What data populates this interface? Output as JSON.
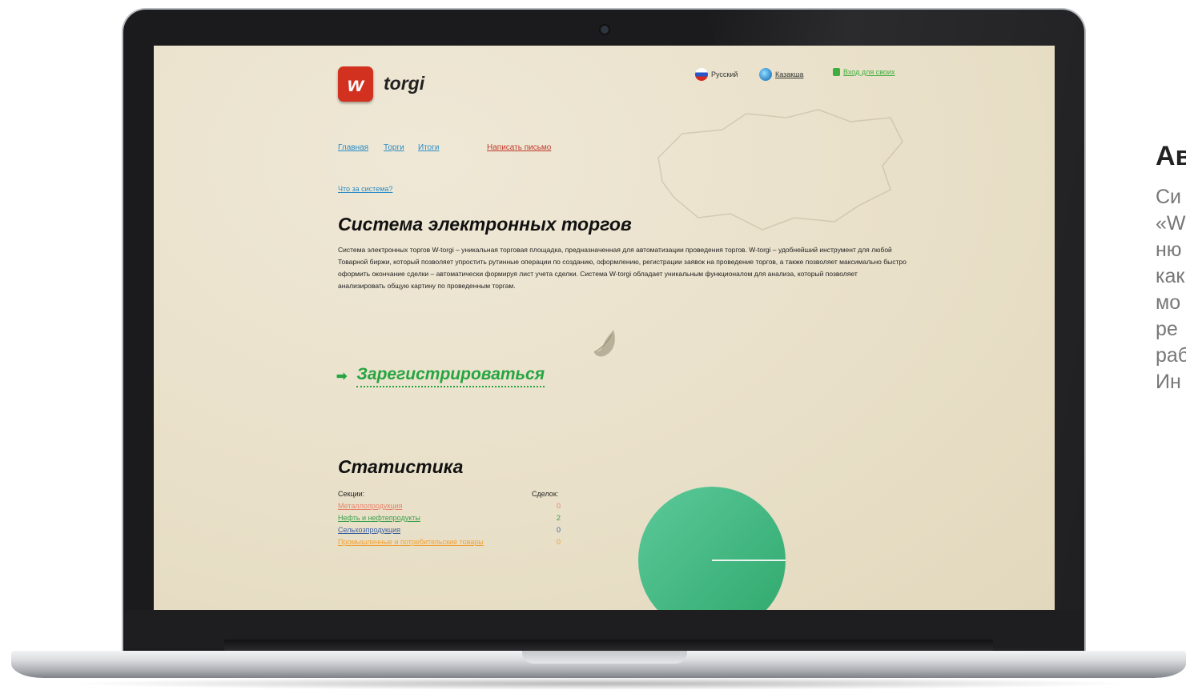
{
  "brand": {
    "logo_letter": "w",
    "name": "torgi",
    "logo_color": "#d2311f"
  },
  "header": {
    "lang_ru": "Русский",
    "lang_kz": "Казакша",
    "login": "Вход для своих"
  },
  "nav": {
    "home": "Главная",
    "auctions": "Торги",
    "results": "Итоги",
    "write": "Написать письмо"
  },
  "what_is": "Что за система?",
  "main": {
    "title": "Система электронных торгов",
    "description": "Система электронных торгов W-torgi – уникальная торговая площадка, предназначенная для автоматизации проведения торгов. W-torgi – удобнейший инструмент для любой Товарной биржи, который позволяет упростить рутинные операции по созданию, оформлению, регистрации заявок на проведение торгов, а также позволяет максимально быстро оформить окончание сделки – автоматически формируя лист учета сделки. Система W-torgi обладает уникальным функционалом для анализа, который позволяет анализировать общую картину по проведенным торгам.",
    "register": "Зарегистрироваться",
    "accent": "#26a541"
  },
  "stats": {
    "title": "Статистика",
    "col_section": "Секции:",
    "col_deals": "Сделок:",
    "rows": [
      {
        "name": "Металлопродукция",
        "value": "0",
        "color": "#e8826a"
      },
      {
        "name": "Нефть и нефтепродукты",
        "value": "2",
        "color": "#3aa04a"
      },
      {
        "name": "Сельхозпродукция",
        "value": "0",
        "color": "#3a5fa0"
      },
      {
        "name": "Промышленные и потребительские товары",
        "value": "0",
        "color": "#f0a030"
      }
    ],
    "pie_color": "#3bb780"
  },
  "side": {
    "title": "Ав",
    "lines": [
      "Си",
      "«W",
      "ню",
      "как",
      "мо",
      "ре",
      "раб",
      "Ин"
    ]
  }
}
